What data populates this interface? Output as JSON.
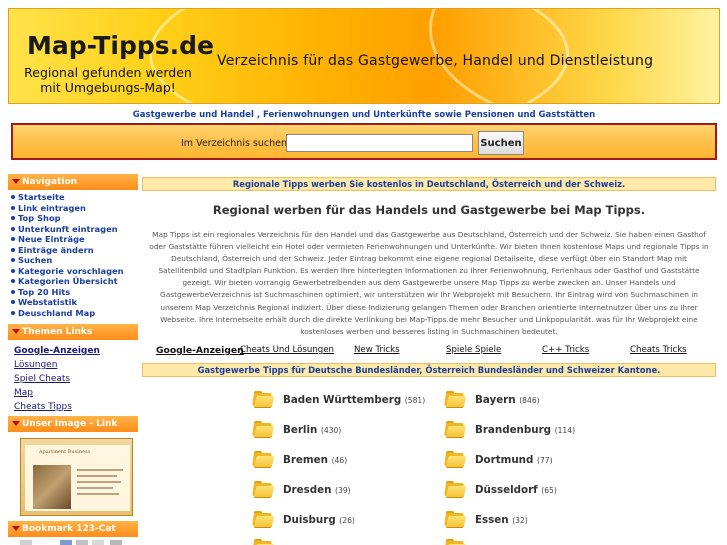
{
  "header": {
    "logo_title": "Map-Tipps.de",
    "logo_subtitle_line1": "Regional gefunden werden",
    "logo_subtitle_line2": "mit Umgebungs-Map!",
    "tagline": "Verzeichnis für das Gastgewerbe, Handel und Dienstleistung"
  },
  "topbar": {
    "text": "Gastgewerbe und Handel , Ferienwohnungen und Unterkünfte sowie Pensionen und Gaststätten"
  },
  "search": {
    "label": "Im Verzeichnis suchen:",
    "value": "",
    "button_label": "Suchen"
  },
  "sidebar": {
    "navigation_title": "Navigation",
    "nav_items": [
      "Startseite",
      "Link eintragen",
      "Top Shop",
      "Unterkunft eintragen",
      "Neue Einträge",
      "Einträge ändern",
      "Suchen",
      "Kategorie vorschlagen",
      "Kategorien Übersicht",
      "Top 20 Hits",
      "Webstatistik",
      "Deuschland Map"
    ],
    "themen_title": "Themen Links",
    "themen_items": [
      "Google-Anzeigen",
      "Lösungen",
      "Spiel Cheats",
      "Map",
      "Cheats Tipps"
    ],
    "user_image_title": "Unser Image - Link",
    "user_image_caption": "Apartment Business",
    "bookmark_title": "Bookmark 123-Cat"
  },
  "main": {
    "promo": "Regionale Tipps werben Sie kostenlos in Deutschland, Österreich und der Schweiz.",
    "intro_title": "Regional werben für das Handels und Gastgewerbe bei Map Tipps.",
    "intro_text": "Map Tipps ist ein regionales Verzeichnis für den Handel und das Gastgewerbe aus Deutschland, Österreich und der Schweiz. Sie haben einen Gasthof oder Gaststätte führen vielleicht ein Hotel oder vermieten Ferienwohnungen und Unterkünfte. Wir bieten Ihnen kostenlose Maps und regionale Tipps in Deutschland, Österreich und der Schweiz. Jeder Eintrag bekommt eine eigene regional Detailseite, diese verfügt über ein Standort Map mit Satellitenbild und Stadtplan Funktion. Es werden Ihre hinterlegten Informationen zu Ihrer Ferienwohnung, Ferienhaus oder Gasthof und Gaststätte gezeigt. Wir bieten vorrangig Gewerbetreibenden aus dem Gastgewerbe unsere Map Tipps zu werbe zwecken an. Unser Handels und GastgewerbeVerzeichnis ist Suchmaschinen optimiert, wir unterstützen wir Ihr Webprojekt mit Besuchern. Ihr Eintrag wird von Suchmaschinen in unserem Map Verzeichnis Regional indiziert. Über diese Indizierung gelangen Themen oder Branchen orientierte Internetnutzer über uns zu Ihrer Webseite. Ihre Internetseite erhält durch die direkte Verlinkung bei Map-Tipps.de mehr Besucher und Linkpopularität. was für Ihr Webprojekt eine kostenloses werben und besseres listing in Suchmaschinen bedeutet.",
    "links": [
      "Google-Anzeigen",
      "Cheats Und Lösungen",
      "New Tricks",
      "Spiele Spiele",
      "C++ Tricks",
      "Cheats Tricks"
    ],
    "states_bar": "Gastgewerbe Tipps für Deutsche Bundesländer, Österreich Bundesländer und Schweizer Kantone.",
    "regions": [
      {
        "name": "Baden Württemberg",
        "count": "(581)"
      },
      {
        "name": "Bayern",
        "count": "(846)"
      },
      {
        "name": "Berlin",
        "count": "(430)"
      },
      {
        "name": "Brandenburg",
        "count": "(114)"
      },
      {
        "name": "Bremen",
        "count": "(46)"
      },
      {
        "name": "Dortmund",
        "count": "(77)"
      },
      {
        "name": "Dresden",
        "count": "(39)"
      },
      {
        "name": "Düsseldorf",
        "count": "(65)"
      },
      {
        "name": "Duisburg",
        "count": "(26)"
      },
      {
        "name": "Essen",
        "count": "(32)"
      }
    ]
  },
  "colors": {
    "link_blue": "#1a3fa0",
    "orange_head": "#ff8c1a",
    "search_border": "#a01a1a",
    "bar_bg": "#ffe9a8"
  }
}
